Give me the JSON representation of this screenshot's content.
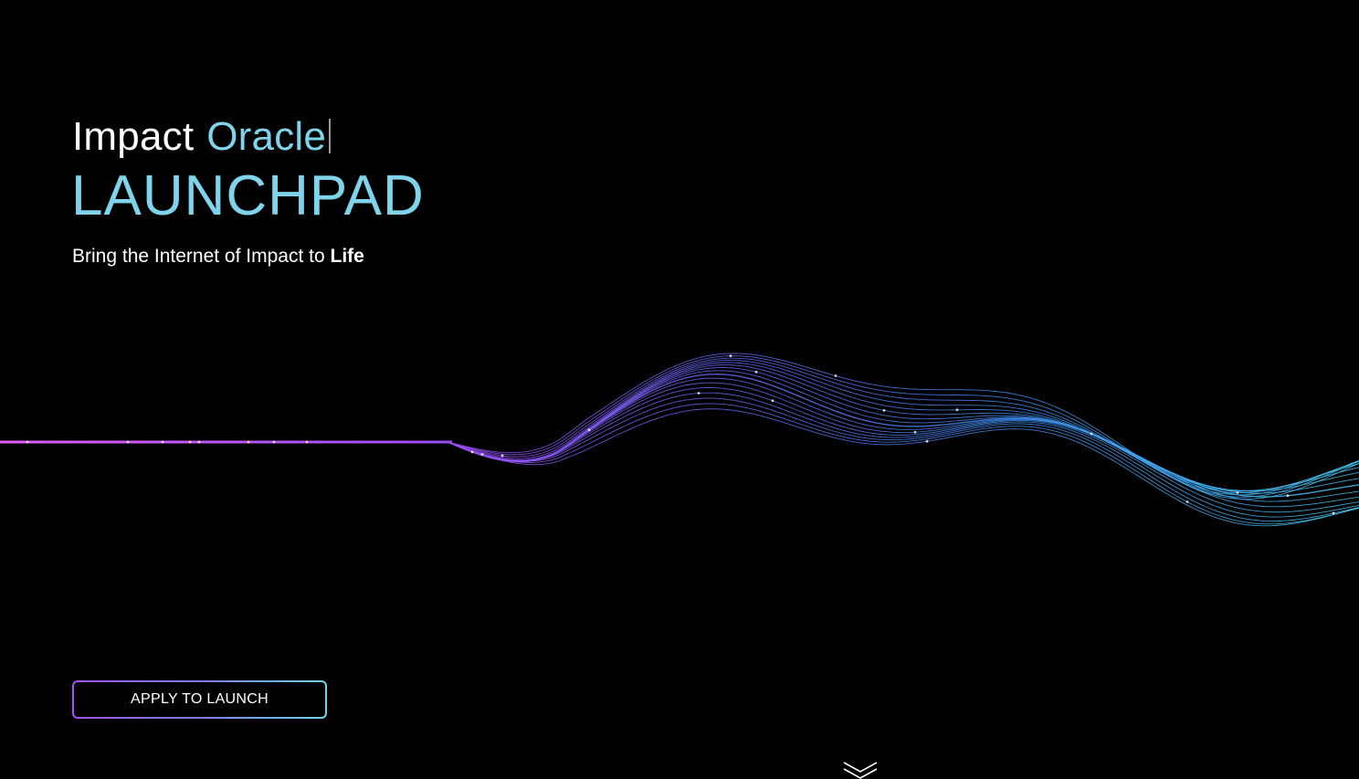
{
  "hero": {
    "title_word1": "Impact",
    "title_word2": "Oracle",
    "launchpad": "LAUNCHPAD",
    "tagline_prefix": "Bring the Internet of Impact to ",
    "tagline_emphasis": "Life"
  },
  "cta": {
    "label": "APPLY TO LAUNCH"
  },
  "icons": {
    "scroll": "double-chevron-down-icon",
    "wave": "wave-graphic"
  },
  "colors": {
    "background": "#000000",
    "accent_cyan": "#7fd3ea",
    "wave_start": "#e05cff",
    "wave_mid": "#6b63f0",
    "wave_end": "#47c6f0"
  }
}
